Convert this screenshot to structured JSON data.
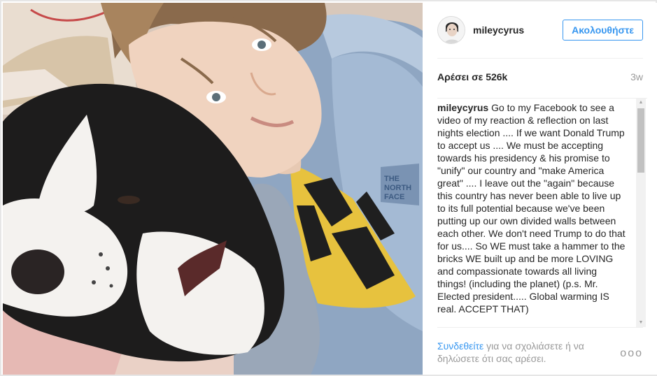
{
  "post": {
    "username": "mileycyrus",
    "follow_label": "Ακολουθήστε",
    "likes": "Αρέσει σε 526k",
    "time_ago": "3w",
    "caption_user": "mileycyrus",
    "caption_text": "Go to my Facebook to see a video of my reaction & reflection on last nights election .... If we want Donald Trump to accept us .... We must be accepting towards his presidency & his promise to \"unify\" our country and \"make America great\" .... I leave out the \"again\" because this country has never been able to live up to its full potential because we've been putting up our own divided walls between each other. We don't need Trump to do that for us.... So WE must take a hammer to the bricks WE built up and be more LOVING and compassionate towards all living things! (including the planet) (p.s. Mr. Elected president..... Global warming IS real. ACCEPT THAT)"
  },
  "footer": {
    "login_link": "Συνδεθείτε",
    "login_text": " για να σχολιάσετε ή να δηλώσετε ότι σας αρέσει.",
    "more_label": "ooo"
  },
  "icons": {
    "avatar": "profile-avatar",
    "scroll_up": "scroll-up-arrow",
    "scroll_down": "scroll-down-arrow"
  },
  "colors": {
    "accent": "#3897f0",
    "muted": "#999999",
    "text": "#262626"
  }
}
